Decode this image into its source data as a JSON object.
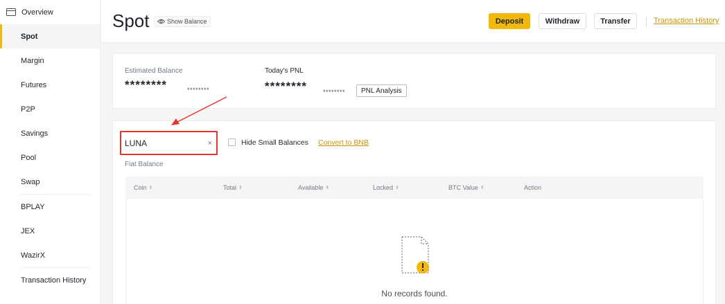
{
  "sidebar": {
    "items": [
      {
        "label": "Overview"
      },
      {
        "label": "Spot"
      },
      {
        "label": "Margin"
      },
      {
        "label": "Futures"
      },
      {
        "label": "P2P"
      },
      {
        "label": "Savings"
      },
      {
        "label": "Pool"
      },
      {
        "label": "Swap"
      },
      {
        "label": "BPLAY"
      },
      {
        "label": "JEX"
      },
      {
        "label": "WazirX"
      },
      {
        "label": "Transaction History"
      }
    ]
  },
  "header": {
    "title": "Spot",
    "show_balance": "Show Balance",
    "deposit": "Deposit",
    "withdraw": "Withdraw",
    "transfer": "Transfer",
    "transaction_history": "Transaction History"
  },
  "balance": {
    "estimated_label": "Estimated Balance",
    "estimated_value": "********",
    "estimated_sub": "********",
    "pnl_label": "Today's PNL",
    "pnl_value": "********",
    "pnl_sub": "********",
    "pnl_analysis": "PNL Analysis"
  },
  "assets": {
    "search_value": "LUNA",
    "search_clear": "×",
    "hide_small": "Hide Small Balances",
    "convert": "Convert to BNB",
    "fiat": "Fiat Balance",
    "columns": [
      "Coin",
      "Total",
      "Available",
      "Locked",
      "BTC Value",
      "Action"
    ],
    "empty": "No records found."
  },
  "colors": {
    "accent": "#f0b90b",
    "link": "#c99400",
    "highlight": "#e0362e"
  }
}
